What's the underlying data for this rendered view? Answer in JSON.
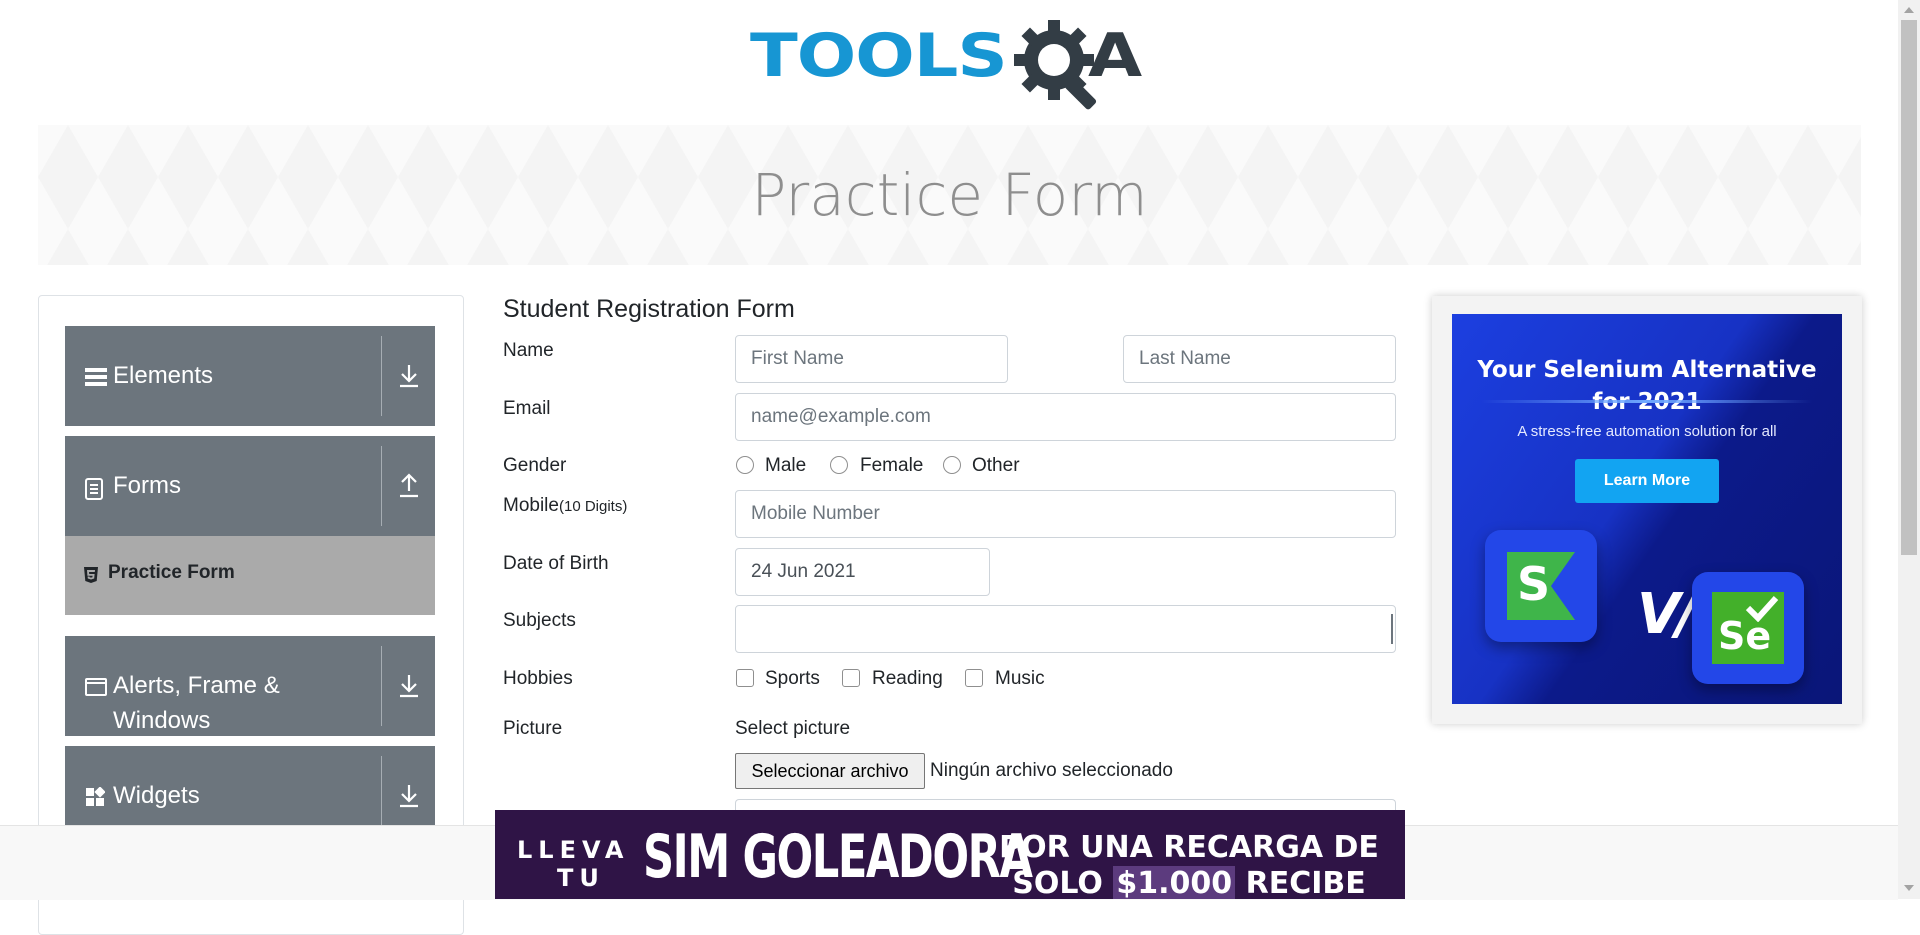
{
  "logo": {
    "text_tools": "TOOLS",
    "text_a": "A",
    "brand_blue": "#1796d3",
    "brand_dark": "#333d45"
  },
  "banner": {
    "title": "Practice Form"
  },
  "sidebar": {
    "groups": [
      {
        "label": "Elements",
        "icon": "hamburger-icon",
        "arrow": "download-arrow-icon"
      },
      {
        "label": "Forms",
        "icon": "document-icon",
        "arrow": "upload-arrow-icon"
      },
      {
        "label": "Alerts, Frame & Windows",
        "label_line1": "Alerts, Frame &",
        "label_line2": "Windows",
        "icon": "window-icon",
        "arrow": "download-arrow-icon"
      },
      {
        "label": "Widgets",
        "icon": "widgets-icon",
        "arrow": "download-arrow-icon"
      }
    ],
    "active_item": {
      "label": "Practice Form",
      "icon": "html5-icon"
    }
  },
  "form": {
    "title": "Student Registration Form",
    "name_label": "Name",
    "first_name_placeholder": "First Name",
    "last_name_placeholder": "Last Name",
    "email_label": "Email",
    "email_placeholder": "name@example.com",
    "gender_label": "Gender",
    "gender_options": [
      "Male",
      "Female",
      "Other"
    ],
    "mobile_label": "Mobile",
    "mobile_hint": "(10 Digits)",
    "mobile_placeholder": "Mobile Number",
    "dob_label": "Date of Birth",
    "dob_value": "24 Jun 2021",
    "subjects_label": "Subjects",
    "hobbies_label": "Hobbies",
    "hobbies_options": [
      "Sports",
      "Reading",
      "Music"
    ],
    "picture_label": "Picture",
    "select_picture": "Select picture",
    "file_button": "Seleccionar archivo",
    "file_status": "Ningún archivo seleccionado"
  },
  "ad": {
    "headline_line1": "Your Selenium Alternative",
    "headline_line2": "for 2021",
    "subtitle": "A stress-free automation solution for all",
    "button": "Learn More",
    "vs": "V/s",
    "se_text": "Se",
    "s_text": "S"
  },
  "bottom_ad": {
    "line1": "LLEVA",
    "line2": "TU",
    "big": "SIM GOLEADORA",
    "right_line1": "POR UNA RECARGA DE",
    "right_pre": "SOLO",
    "right_amount": "$1.000",
    "right_post": "RECIBE"
  }
}
